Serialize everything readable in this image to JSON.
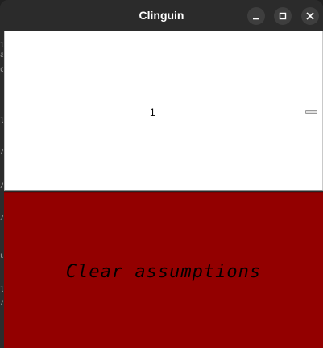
{
  "window": {
    "title": "Clinguin"
  },
  "background_glimpse": [
    "l",
    "a",
    "o",
    "l",
    "/",
    "/",
    "/",
    "u",
    "l",
    "/"
  ],
  "assumptions_panel": {
    "value": "1"
  },
  "clear_button": {
    "label": "Clear assumptions",
    "color": "#930000"
  },
  "colors": {
    "titlebar": "#2b2b2b",
    "panel": "#ffffff",
    "button": "#930000"
  },
  "icons": [
    "minimize-icon",
    "maximize-icon",
    "close-icon"
  ]
}
